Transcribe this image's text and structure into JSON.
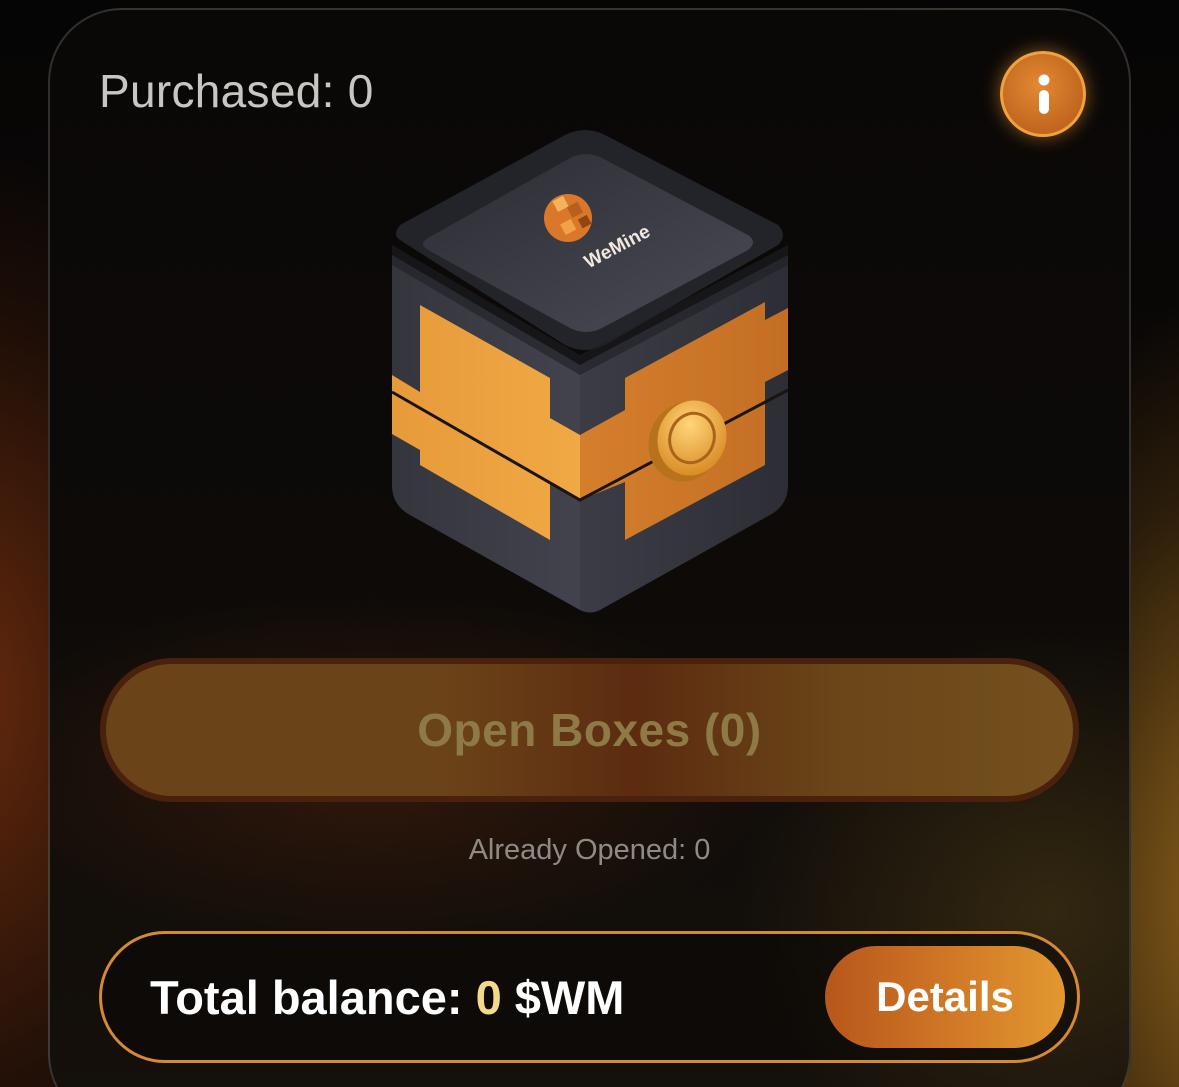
{
  "card": {
    "purchased_label": "Purchased: 0",
    "info_icon": "info-icon",
    "box_brand": "WeMine",
    "open_button_label": "Open Boxes (0)",
    "already_opened_label": "Already Opened: 0",
    "balance": {
      "label": "Total balance:",
      "value": "0",
      "currency": "$WM"
    },
    "details_button_label": "Details"
  },
  "colors": {
    "accent": "#d58935",
    "accent_bright": "#e3982f",
    "balance_value": "#f3d98a",
    "open_button_text_disabled": "#8d7a46"
  }
}
